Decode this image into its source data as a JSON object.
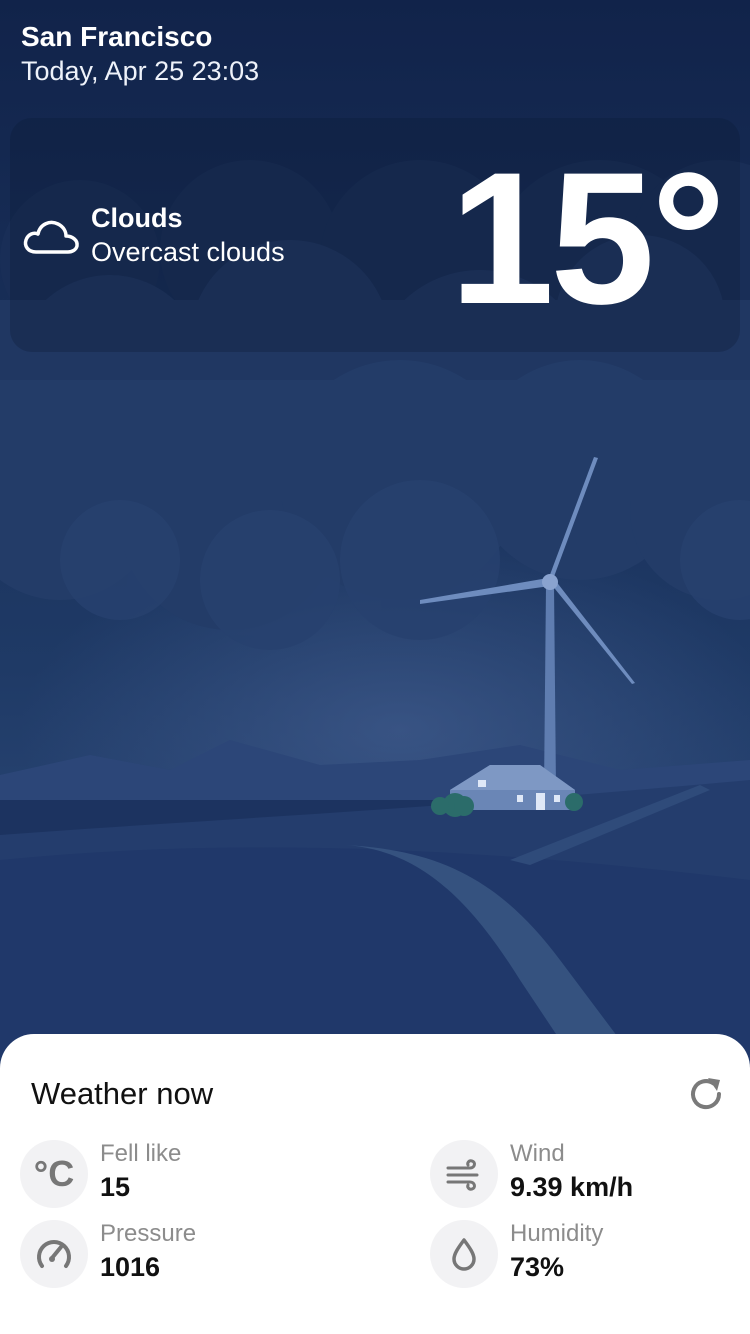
{
  "location": {
    "city": "San Francisco",
    "datetime": "Today, Apr 25 23:03"
  },
  "current": {
    "condition": "Clouds",
    "description": "Overcast clouds",
    "temperature": "15°",
    "icon": "cloud-icon"
  },
  "panel": {
    "title": "Weather now",
    "refresh_icon": "refresh-icon",
    "metrics": {
      "feels_like": {
        "label": "Fell like",
        "value": "15",
        "icon": "celsius-icon"
      },
      "wind": {
        "label": "Wind",
        "value": "9.39 km/h",
        "icon": "wind-icon"
      },
      "pressure": {
        "label": "Pressure",
        "value": "1016",
        "icon": "gauge-icon"
      },
      "humidity": {
        "label": "Humidity",
        "value": "73%",
        "icon": "droplet-icon"
      }
    }
  },
  "colors": {
    "sky_top": "#12254a",
    "sky_bottom": "#2c4774",
    "cloud": "#263f69",
    "ground": "#1f3563",
    "panel_bg": "#ffffff",
    "icon_circle": "#f2f2f4",
    "icon_gray": "#777777"
  }
}
